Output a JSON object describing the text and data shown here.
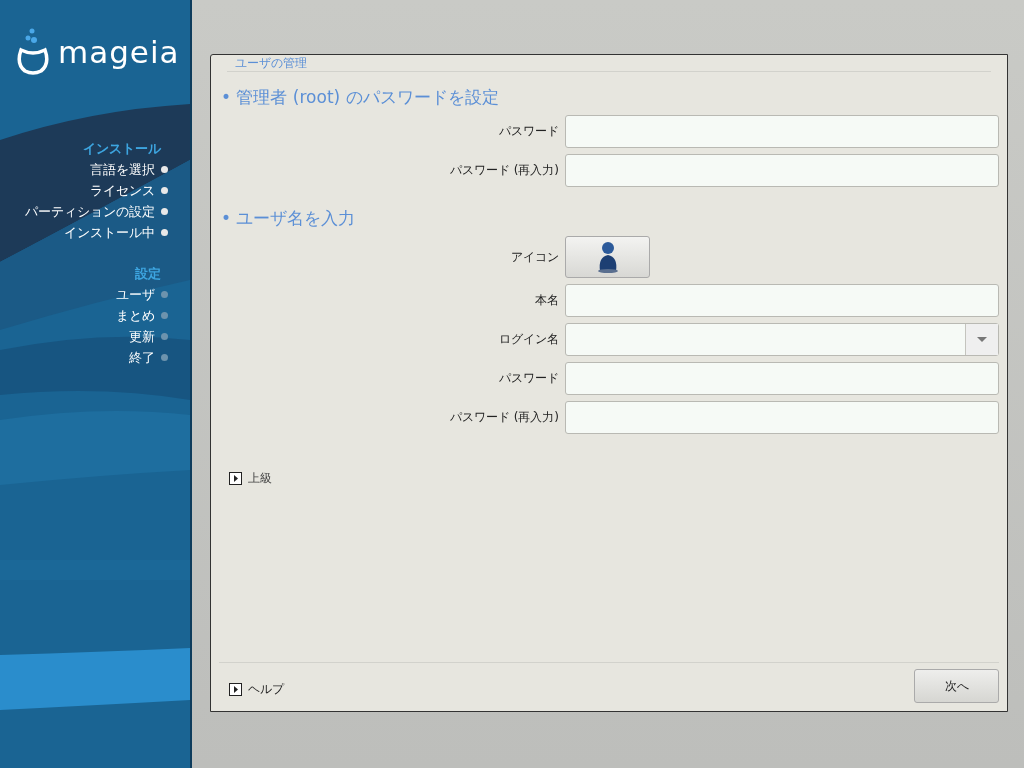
{
  "sidebar": {
    "logo": "mageia",
    "sections": [
      {
        "title": "インストール",
        "items": [
          {
            "label": "言語を選択",
            "done": true
          },
          {
            "label": "ライセンス",
            "done": true
          },
          {
            "label": "パーティションの設定",
            "done": true
          },
          {
            "label": "インストール中",
            "done": true
          }
        ]
      },
      {
        "title": "設定",
        "items": [
          {
            "label": "ユーザ",
            "done": false
          },
          {
            "label": "まとめ",
            "done": false
          },
          {
            "label": "更新",
            "done": false
          },
          {
            "label": "終了",
            "done": false
          }
        ]
      }
    ]
  },
  "dialog": {
    "title": "ユーザの管理",
    "sections": [
      {
        "heading": "• 管理者 (root) のパスワードを設定",
        "fields": [
          {
            "kind": "text",
            "label": "パスワード"
          },
          {
            "kind": "text",
            "label": "パスワード (再入力)"
          }
        ]
      },
      {
        "heading": "• ユーザ名を入力",
        "fields": [
          {
            "kind": "icon",
            "label": "アイコン"
          },
          {
            "kind": "text",
            "label": "本名"
          },
          {
            "kind": "combo",
            "label": "ログイン名"
          },
          {
            "kind": "text",
            "label": "パスワード"
          },
          {
            "kind": "text",
            "label": "パスワード (再入力)"
          }
        ]
      }
    ],
    "advanced": {
      "label": "上級"
    },
    "help": {
      "label": "ヘルプ"
    },
    "next_button": "次へ"
  }
}
